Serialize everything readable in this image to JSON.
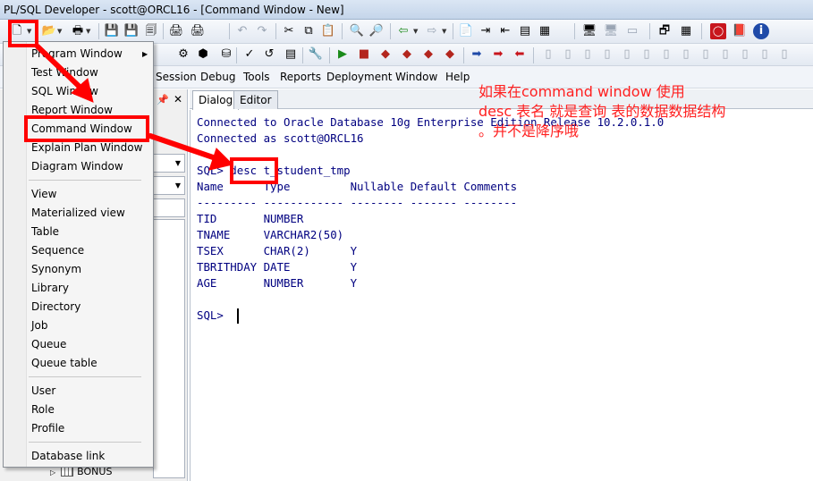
{
  "window": {
    "title": "PL/SQL Developer - scott@ORCL16 - [Command Window - New]"
  },
  "menubar": {
    "items": [
      "Session",
      "Debug",
      "Tools",
      "Reports",
      "Deployment",
      "Window",
      "Help"
    ]
  },
  "new_menu": {
    "items": [
      "Program Window",
      "Test Window",
      "SQL Window",
      "Report Window",
      "Command Window",
      "Explain Plan Window",
      "Diagram Window",
      "View",
      "Materialized view",
      "Table",
      "Sequence",
      "Synonym",
      "Library",
      "Directory",
      "Job",
      "Queue",
      "Queue table",
      "User",
      "Role",
      "Profile",
      "Database link"
    ]
  },
  "left_panel": {
    "tree_item": "BONUS"
  },
  "editor": {
    "tabs": [
      "Dialog",
      "Editor"
    ],
    "lines": [
      "Connected to Oracle Database 10g Enterprise Edition Release 10.2.0.1.0",
      "Connected as scott@ORCL16",
      "",
      "SQL> desc t_student_tmp",
      "Name      Type         Nullable Default Comments",
      "--------- ------------ -------- ------- --------",
      "TID       NUMBER",
      "TNAME     VARCHAR2(50)",
      "TSEX      CHAR(2)      Y",
      "TBRITHDAY DATE         Y",
      "AGE       NUMBER       Y",
      "",
      "SQL> "
    ]
  },
  "annotation": {
    "line1": "如果在command window 使用",
    "line2": "desc 表名 就是查询 表的数据数据结构",
    "line3": "。并不是降序哦",
    "color": "#ff1f1f"
  }
}
